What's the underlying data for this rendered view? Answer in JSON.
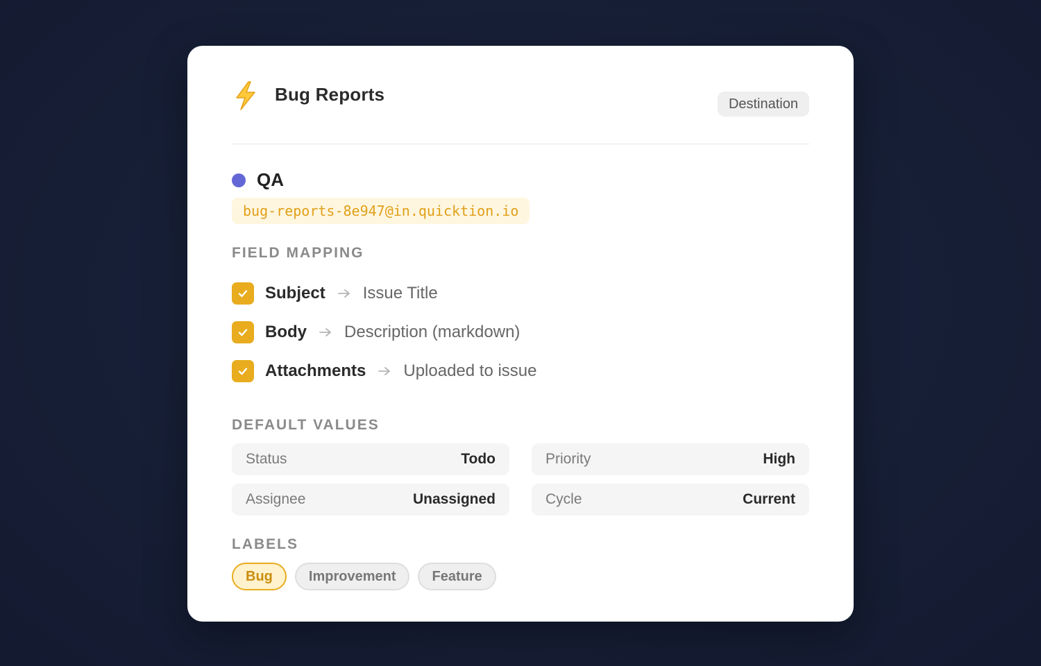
{
  "card": {
    "title": "Bug Reports",
    "badge": "Destination",
    "icon": "lightning-icon"
  },
  "team": {
    "name": "QA",
    "color": "#6367d6",
    "email": "bug-reports-8e947@in.quicktion.io"
  },
  "field_mapping": {
    "label": "FIELD MAPPING",
    "items": [
      {
        "source": "Subject",
        "target": "Issue Title",
        "checked": true
      },
      {
        "source": "Body",
        "target": "Description (markdown)",
        "checked": true
      },
      {
        "source": "Attachments",
        "target": "Uploaded to issue",
        "checked": true
      }
    ]
  },
  "default_values": {
    "label": "DEFAULT VALUES",
    "items": [
      {
        "key": "Status",
        "value": "Todo"
      },
      {
        "key": "Priority",
        "value": "High"
      },
      {
        "key": "Assignee",
        "value": "Unassigned"
      },
      {
        "key": "Cycle",
        "value": "Current"
      }
    ]
  },
  "labels": {
    "label": "LABELS",
    "items": [
      {
        "text": "Bug",
        "selected": true
      },
      {
        "text": "Improvement",
        "selected": false
      },
      {
        "text": "Feature",
        "selected": false
      }
    ]
  },
  "colors": {
    "accent": "#e8ac1e",
    "team_dot": "#6367d6"
  }
}
